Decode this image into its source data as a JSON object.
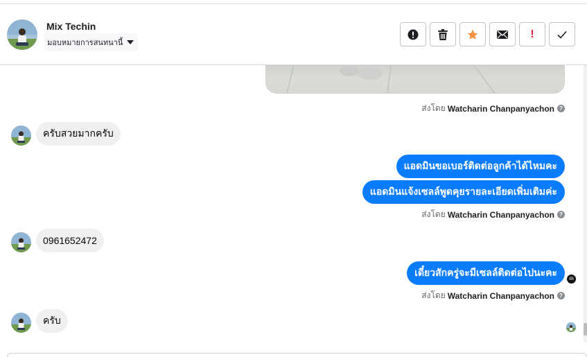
{
  "header": {
    "contact_name": "Mix Techin",
    "assign_label": "มอบหมายการสนทนานี้",
    "toolbar": {
      "icons": [
        "alert-circle-icon",
        "trash-icon",
        "star-icon",
        "envelope-icon",
        "exclamation-icon",
        "checkmark-icon"
      ],
      "star_color": "#f7923b",
      "exclamation_text": "!",
      "exclamation_color": "#e41e3f"
    }
  },
  "messages": [
    {
      "type": "sent-by",
      "prefix": "ส่งโดย",
      "sender": "Watcharin Chanpanyachon"
    },
    {
      "type": "incoming",
      "text": "ครับสวยมากครับ"
    },
    {
      "type": "outgoing",
      "text": "แอดมินขอเบอร์ติดต่อลูกค้าได้ไหมคะ"
    },
    {
      "type": "outgoing",
      "text": "แอดมินแจ้งเซลล์พูดคุยรายละเอียดเพิ่มเติมค่ะ"
    },
    {
      "type": "sent-by",
      "prefix": "ส่งโดย",
      "sender": "Watcharin Chanpanyachon"
    },
    {
      "type": "incoming",
      "text": "0961652472"
    },
    {
      "type": "outgoing",
      "text": "เดี๋ยวสักครู่จะมีเซลล์ติดต่อไปนะคะ"
    },
    {
      "type": "sent-by",
      "prefix": "ส่งโดย",
      "sender": "Watcharin Chanpanyachon"
    },
    {
      "type": "incoming",
      "text": "ครับ"
    }
  ],
  "colors": {
    "outgoing_bubble": "#0a7cff",
    "incoming_bubble": "#f0f0f0"
  }
}
